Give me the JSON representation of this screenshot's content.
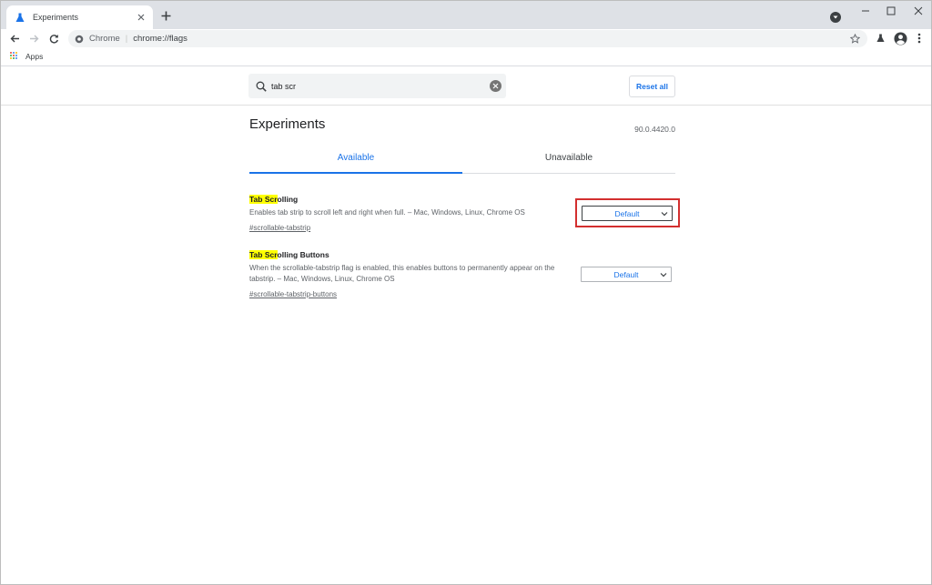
{
  "browser": {
    "tab_title": "Experiments",
    "omnibox_chip": "Chrome",
    "omnibox_url": "chrome://flags",
    "bookmarks": [
      {
        "label": "Apps"
      }
    ]
  },
  "flags": {
    "search_value": "tab scr",
    "reset_label": "Reset all",
    "heading": "Experiments",
    "version": "90.0.4420.0",
    "tabs": [
      {
        "label": "Available",
        "active": true
      },
      {
        "label": "Unavailable",
        "active": false
      }
    ],
    "experiments": [
      {
        "name_highlight": "Tab Scr",
        "name_rest": "olling",
        "description": "Enables tab strip to scroll left and right when full. – Mac, Windows, Linux, Chrome OS",
        "link": "#scrollable-tabstrip",
        "selected": "Default"
      },
      {
        "name_highlight": "Tab Scr",
        "name_rest": "olling Buttons",
        "description": "When the scrollable-tabstrip flag is enabled, this enables buttons to permanently appear on the tabstrip. – Mac, Windows, Linux, Chrome OS",
        "link": "#scrollable-tabstrip-buttons",
        "selected": "Default"
      }
    ]
  },
  "colors": {
    "accent": "#1a73e8",
    "highlight": "#ffff00",
    "annotation_box": "#d32f2f"
  }
}
